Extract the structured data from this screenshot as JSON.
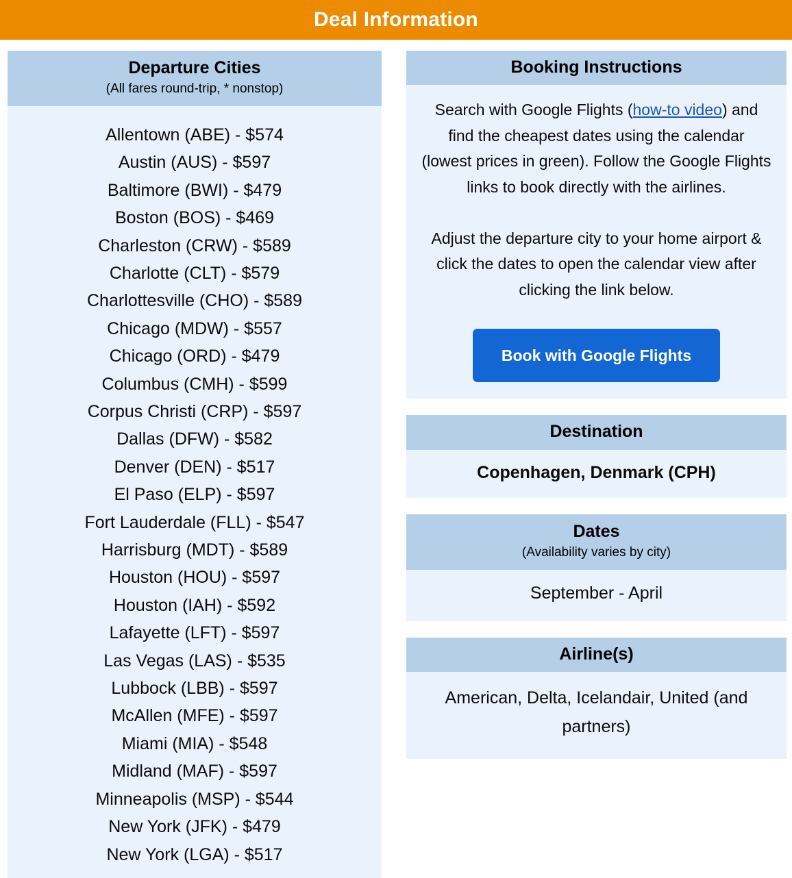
{
  "header": {
    "title": "Deal Information",
    "background_color": "#ED8B00",
    "text_color": "#FFFFFF"
  },
  "theme": {
    "panel_header_color": "#B4CFE7",
    "panel_body_color": "#EAF3FC",
    "button_color": "#1267D4",
    "link_color": "#1A55B8",
    "page_background": "#FFFFFF"
  },
  "departure_cities": {
    "title": "Departure Cities",
    "subtitle": "(All fares round-trip, * nonstop)",
    "items": [
      "Allentown (ABE) - $574",
      "Austin (AUS) - $597",
      "Baltimore (BWI) - $479",
      "Boston (BOS) - $469",
      "Charleston (CRW) - $589",
      "Charlotte (CLT) - $579",
      "Charlottesville (CHO) - $589",
      "Chicago (MDW) - $557",
      "Chicago (ORD) - $479",
      "Columbus (CMH) - $599",
      "Corpus Christi (CRP) - $597",
      "Dallas (DFW) - $582",
      "Denver (DEN) - $517",
      "El Paso (ELP) - $597",
      "Fort Lauderdale (FLL) - $547",
      "Harrisburg (MDT) - $589",
      "Houston (HOU) - $597",
      "Houston (IAH) - $592",
      "Lafayette (LFT) - $597",
      "Las Vegas (LAS) - $535",
      "Lubbock (LBB) - $597",
      "McAllen (MFE) - $597",
      "Miami (MIA) - $548",
      "Midland (MAF) - $597",
      "Minneapolis (MSP) - $544",
      "New York (JFK) - $479",
      "New York (LGA) - $517"
    ]
  },
  "booking_instructions": {
    "title": "Booking Instructions",
    "paragraph_1_before_link": "Search with Google Flights (",
    "link_label": "how-to video",
    "paragraph_1_after_link": ") and find the cheapest dates using the calendar (lowest prices in green). Follow the Google Flights links to book directly with the airlines.",
    "paragraph_2": "Adjust the departure city to your home airport & click the dates to open the calendar view after clicking the link below.",
    "button_label": "Book with Google Flights"
  },
  "destination": {
    "title": "Destination",
    "value": "Copenhagen, Denmark (CPH)"
  },
  "dates": {
    "title": "Dates",
    "subtitle": "(Availability varies by city)",
    "value": "September - April"
  },
  "airlines": {
    "title": "Airline(s)",
    "value": "American, Delta, Icelandair, United (and partners)"
  }
}
